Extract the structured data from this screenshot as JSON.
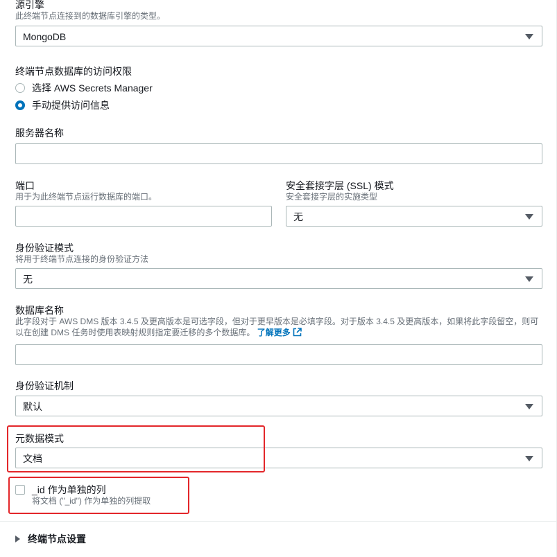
{
  "source_engine": {
    "label": "源引擎",
    "description": "此终端节点连接到的数据库引擎的类型。",
    "value": "MongoDB"
  },
  "access": {
    "label": "终端节点数据库的访问权限",
    "options": [
      {
        "label": "选择 AWS Secrets Manager",
        "checked": false
      },
      {
        "label": "手动提供访问信息",
        "checked": true
      }
    ]
  },
  "server_name": {
    "label": "服务器名称",
    "value": ""
  },
  "port": {
    "label": "端口",
    "description": "用于为此终端节点运行数据库的端口。",
    "value": ""
  },
  "ssl_mode": {
    "label": "安全套接字层 (SSL) 模式",
    "description": "安全套接字层的实施类型",
    "value": "无"
  },
  "auth_mode": {
    "label": "身份验证模式",
    "description": "将用于终端节点连接的身份验证方法",
    "value": "无"
  },
  "database_name": {
    "label": "数据库名称",
    "description_line1": "此字段对于 AWS DMS 版本 3.4.5 及更高版本是可选字段，但对于更早版本是必填字段。对于版本 3.4.5 及更高版本，如果将此字段留空，则可",
    "description_line2": "以在创建 DMS 任务时使用表映射规则指定要迁移的多个数据库。",
    "learn_more": "了解更多",
    "value": ""
  },
  "auth_mechanism": {
    "label": "身份验证机制",
    "value": "默认"
  },
  "metadata_mode": {
    "label": "元数据模式",
    "value": "文档"
  },
  "id_column": {
    "label": "_id 作为单独的列",
    "description": "将文档 (\"_id\") 作为单独的列提取",
    "checked": false
  },
  "endpoint_settings": {
    "label": "终端节点设置"
  },
  "colors": {
    "accent": "#0073bb",
    "highlight": "#e3262a",
    "border": "#aab7b8"
  }
}
